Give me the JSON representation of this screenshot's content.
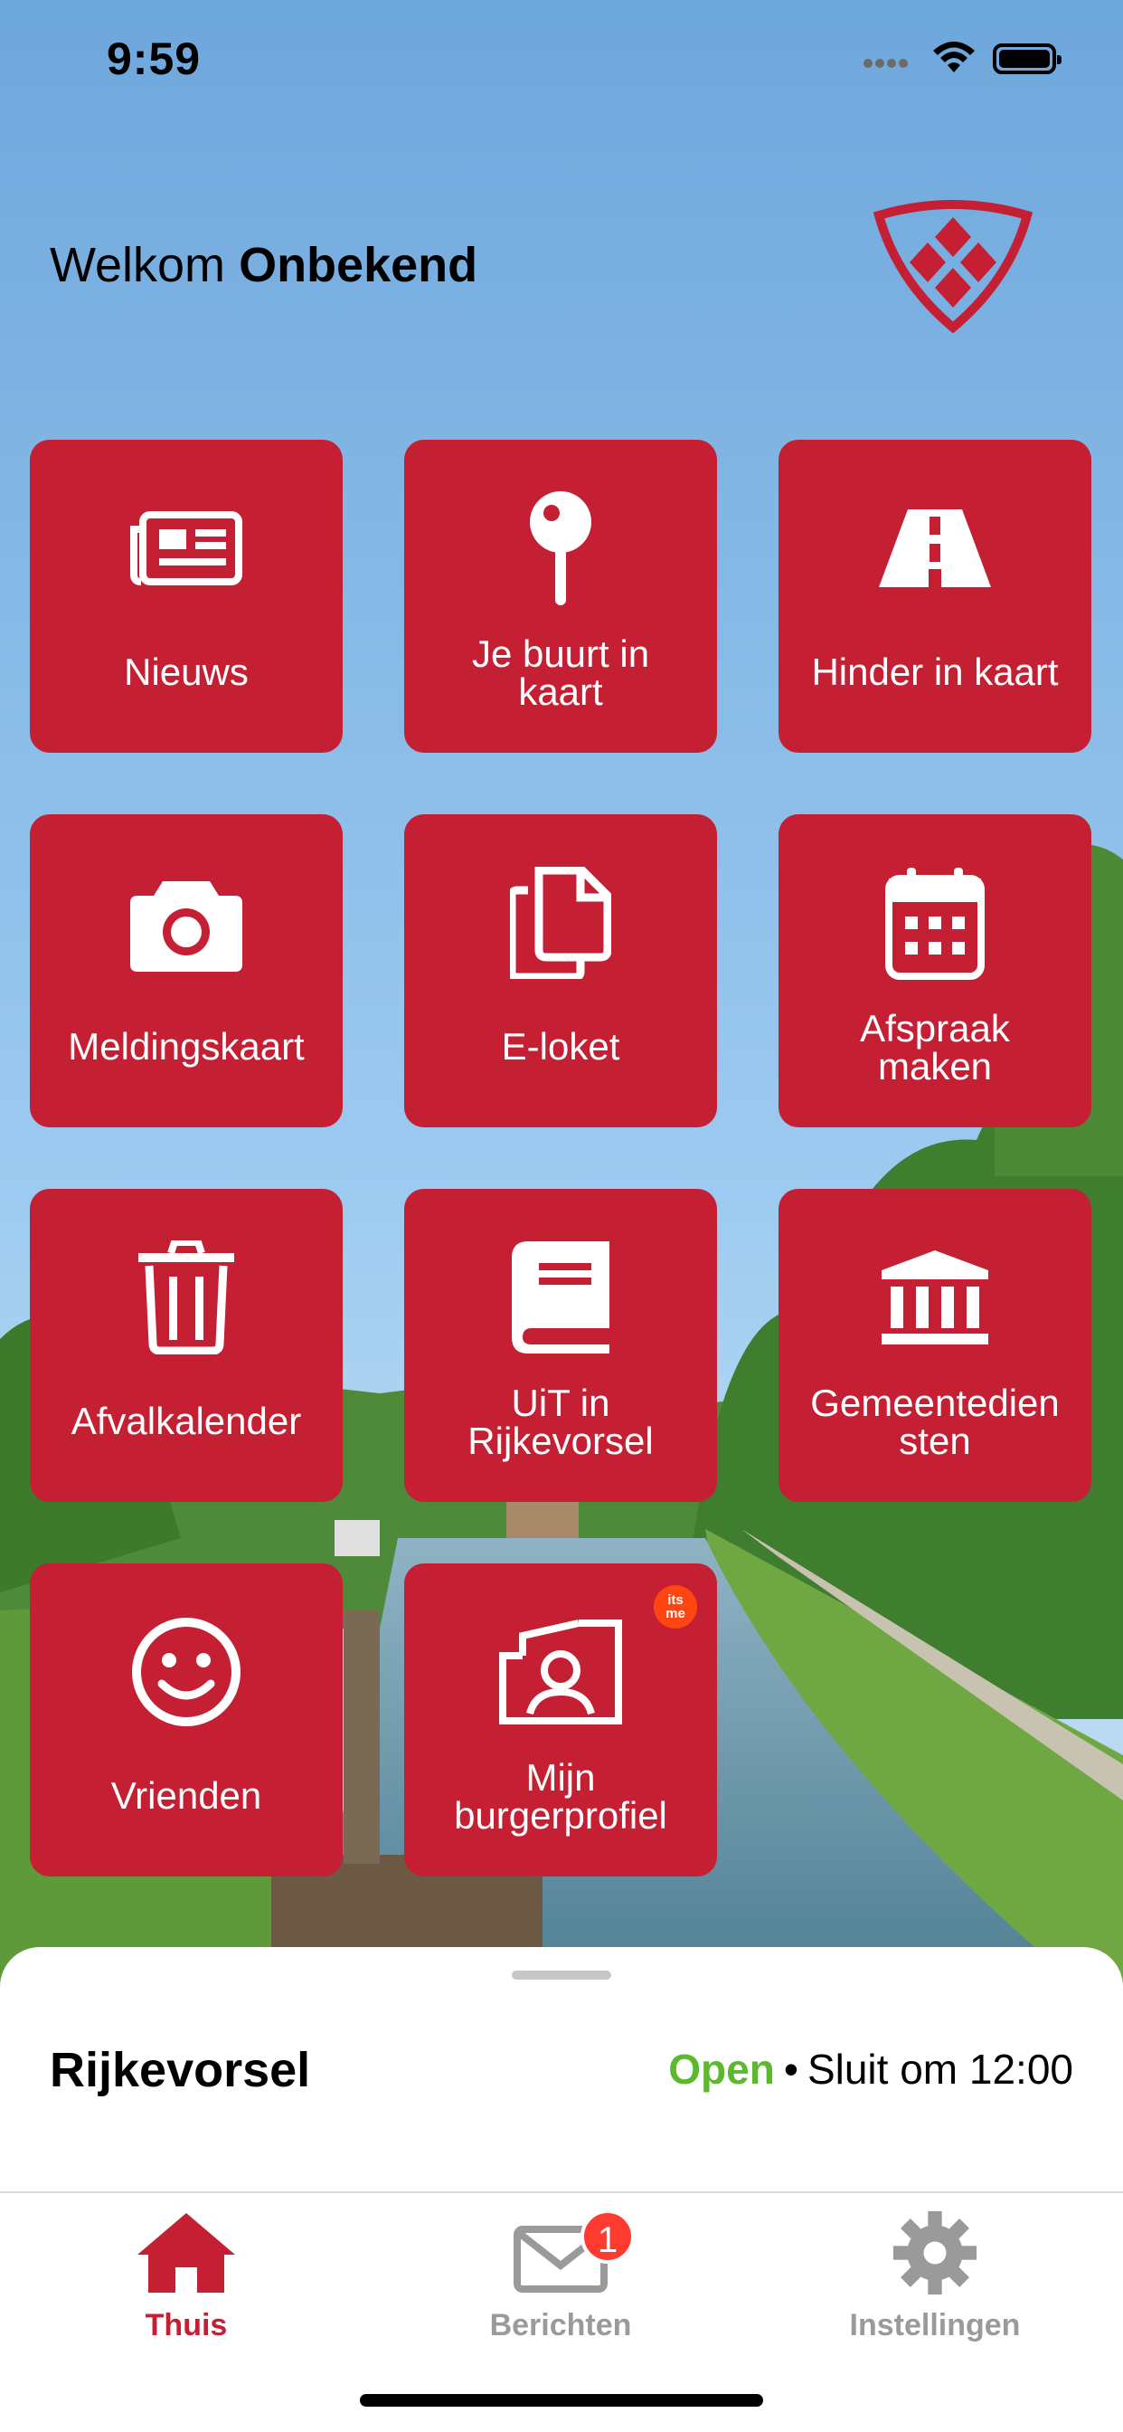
{
  "status_bar": {
    "time": "9:59"
  },
  "header": {
    "welcome_prefix": "Welkom",
    "user_name": "Onbekend"
  },
  "tiles": [
    {
      "label": "Nieuws",
      "icon": "newspaper-icon"
    },
    {
      "label": "Je buurt in kaart",
      "icon": "map-pin-icon"
    },
    {
      "label": "Hinder in kaart",
      "icon": "road-icon"
    },
    {
      "label": "Meldingskaart",
      "icon": "camera-icon"
    },
    {
      "label": "E-loket",
      "icon": "copy-documents-icon"
    },
    {
      "label": "Afspraak maken",
      "icon": "calendar-icon"
    },
    {
      "label": "Afvalkalender",
      "icon": "trash-icon"
    },
    {
      "label": "UiT in Rijkevorsel",
      "icon": "book-icon"
    },
    {
      "label": "Gemeentediensten",
      "icon": "institution-icon"
    },
    {
      "label": "Vrienden",
      "icon": "smiley-icon"
    },
    {
      "label": "Mijn burgerprofiel",
      "icon": "profile-card-icon",
      "badge": "its me"
    }
  ],
  "tile_labels": {
    "buurt_line1": "Je buurt in",
    "buurt_line2": "kaart",
    "afspraak_line1": "Afspraak",
    "afspraak_line2": "maken",
    "uit_line1": "UiT in",
    "uit_line2": "Rijkevorsel",
    "gemeente_line1": "Gemeentedien",
    "gemeente_line2": "sten",
    "burger_line1": "Mijn",
    "burger_line2": "burgerprofiel",
    "itsme_1": "its",
    "itsme_2": "me"
  },
  "bottom_sheet": {
    "place": "Rijkevorsel",
    "status": "Open",
    "separator": "•",
    "closing": "Sluit om 12:00"
  },
  "tab_bar": {
    "items": [
      {
        "label": "Thuis",
        "icon": "home-icon",
        "active": true
      },
      {
        "label": "Berichten",
        "icon": "mail-icon",
        "badge": "1"
      },
      {
        "label": "Instellingen",
        "icon": "gear-icon"
      }
    ]
  },
  "colors": {
    "brand": "#c41f33",
    "open": "#5cb82d",
    "badge": "#ff3b30",
    "inactive": "#9a9a9a"
  }
}
